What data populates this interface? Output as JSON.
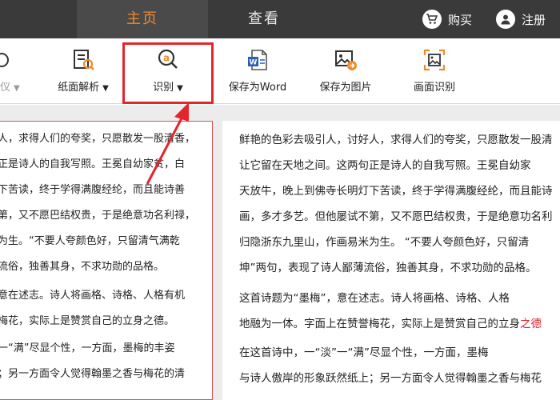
{
  "topbar": {
    "tabs": [
      {
        "label": "主页",
        "active": true
      },
      {
        "label": "查看",
        "active": false
      }
    ],
    "buy_label": "购买",
    "register_label": "注册"
  },
  "toolbar": {
    "items": [
      {
        "label": "仪",
        "icon": "partial-tool-icon"
      },
      {
        "label": "纸面解析",
        "icon": "document-search-icon",
        "caret": "▼"
      },
      {
        "label": "识别",
        "icon": "ocr-magnifier-icon",
        "caret": "▼"
      },
      {
        "label": "保存为Word",
        "icon": "word-doc-icon"
      },
      {
        "label": "保存为图片",
        "icon": "save-image-icon"
      },
      {
        "label": "画面识别",
        "icon": "screen-capture-icon"
      }
    ]
  },
  "colors": {
    "accent": "#f08a2a",
    "topbar_bg": "#3a3a3a",
    "highlight": "#e3262c"
  },
  "left_page": {
    "lines": [
      "人，求得人们的夸奖，只愿散发一股清香，",
      "正是诗人的自我写照。王冕自幼家贫，白",
      "下苦读，终于学得满腹经纶，而且能诗善",
      "第，又不愿巴结权贵，于是绝意功名利禄，",
      "为生。“不要人夸颜色好，只留清气满乾",
      "流俗，独善其身，不求功勋的品格。",
      "意在述志。诗人将画格、诗格、人格有机",
      "梅花，实际上是赞赏自己的立身之德。",
      "一“满”尽显个性，一方面，墨梅的丰姿",
      "；另一方面令人觉得翰墨之香与梅花的清"
    ]
  },
  "right_page": {
    "lines": [
      "鲜艳的色彩去吸引人，讨好人，求得人们的夸奖，只愿散发一股清",
      "让它留在天地之间。这两句正是诗人的自我写照。王冕自幼家",
      "天放牛，晚上到佛寺长明灯下苦读，终于学得满腹经纶，而且能诗",
      "画，多才多艺。但他屡试不第，又不愿巴结权贵，于是绝意功名利",
      "归隐浙东九里山，作画易米为生。    “不要人夸颜色好，只留清",
      "坤”两句，表现了诗人鄙薄流俗，独善其身，不求功勋的品格。",
      "    这首诗题为“墨梅”，意在述志。诗人将画格、诗格、人格",
      "地融为一体。字面上在赞誉梅花，实际上是赞赏自己的立身",
      "    在这首诗中，一“淡”一“满”尽显个性，一方面，墨梅",
      "与诗人傲岸的形象跃然纸上；另一方面令人觉得翰墨之香与梅花"
    ],
    "red_tail": "之德"
  }
}
